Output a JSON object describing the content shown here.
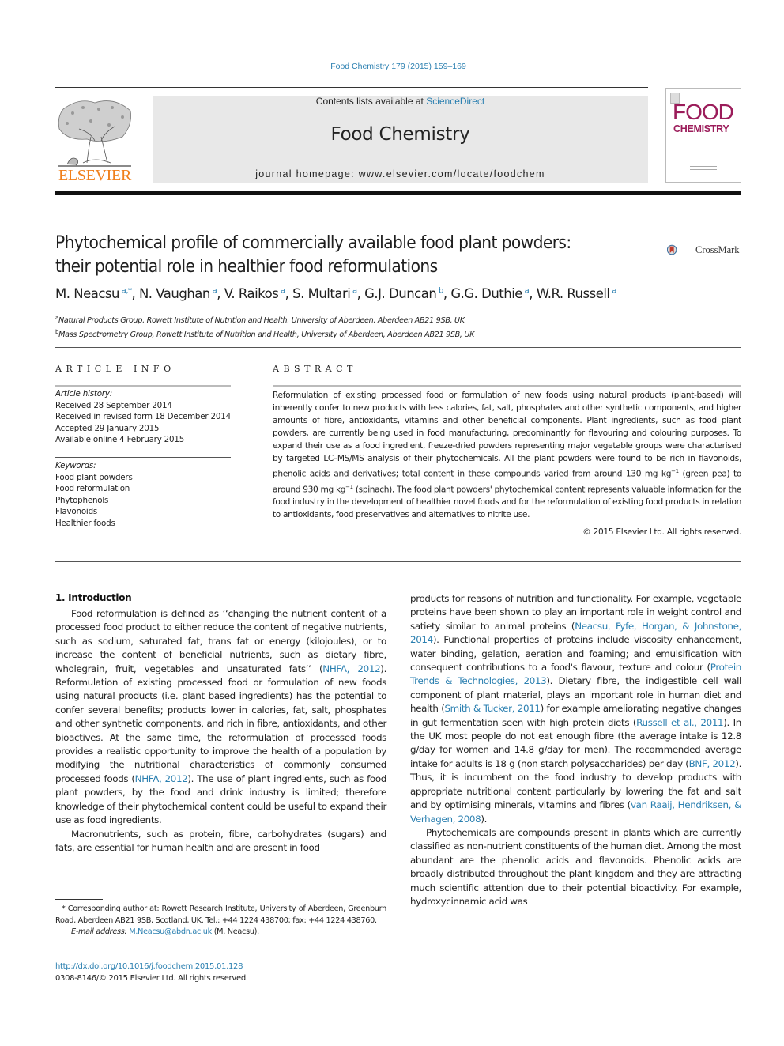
{
  "citation": "Food Chemistry 179 (2015) 159–169",
  "header": {
    "contents_prefix": "Contents lists available at ",
    "contents_link": "ScienceDirect",
    "journal_name": "Food Chemistry",
    "homepage": "journal homepage: www.elsevier.com/locate/foodchem",
    "publisher_logo": "ELSEVIER",
    "cover_line1": "FOOD",
    "cover_line2": "CHEMISTRY",
    "brand_colors": {
      "elsevier_orange": "#f07f1a",
      "cover_magenta": "#9b1c5a",
      "link_blue": "#2a7fb0"
    }
  },
  "article": {
    "title_line1": "Phytochemical profile of commercially available food plant powders:",
    "title_line2": "their potential role in healthier food reformulations",
    "crossmark_label": "CrossMark",
    "authors": [
      {
        "name": "M. Neacsu",
        "aff": "a,*"
      },
      {
        "name": "N. Vaughan",
        "aff": "a"
      },
      {
        "name": "V. Raikos",
        "aff": "a"
      },
      {
        "name": "S. Multari",
        "aff": "a"
      },
      {
        "name": "G.J. Duncan",
        "aff": "b"
      },
      {
        "name": "G.G. Duthie",
        "aff": "a"
      },
      {
        "name": "W.R. Russell",
        "aff": "a"
      }
    ],
    "affiliations": [
      {
        "key": "a",
        "text": "Natural Products Group, Rowett Institute of Nutrition and Health, University of Aberdeen, Aberdeen AB21 9SB, UK"
      },
      {
        "key": "b",
        "text": "Mass Spectrometry Group, Rowett Institute of Nutrition and Health, University of Aberdeen, Aberdeen AB21 9SB, UK"
      }
    ]
  },
  "article_info": {
    "heading": "ARTICLE INFO",
    "history_label": "Article history:",
    "history": [
      "Received 28 September 2014",
      "Received in revised form 18 December 2014",
      "Accepted 29 January 2015",
      "Available online 4 February 2015"
    ],
    "keywords_label": "Keywords:",
    "keywords": [
      "Food plant powders",
      "Food reformulation",
      "Phytophenols",
      "Flavonoids",
      "Healthier foods"
    ]
  },
  "abstract": {
    "heading": "ABSTRACT",
    "part1": "Reformulation of existing processed food or formulation of new foods using natural products (plant-based) will inherently confer to new products with less calories, fat, salt, phosphates and other synthetic components, and higher amounts of fibre, antioxidants, vitamins and other beneficial components. Plant ingredients, such as food plant powders, are currently being used in food manufacturing, predominantly for flavouring and colouring purposes. To expand their use as a food ingredient, freeze-dried powders representing major vegetable groups were characterised by targeted LC–MS/MS analysis of their phytochemicals. All the plant powders were found to be rich in flavonoids, phenolic acids and derivatives; total content in these compounds varied from around 130 mg kg",
    "sup1": "−1",
    "part2": " (green pea) to around 930 mg kg",
    "sup2": "−1",
    "part3": " (spinach). The food plant powders' phytochemical content represents valuable information for the food industry in the development of healthier novel foods and for the reformulation of existing food products in relation to antioxidants, food preservatives and alternatives to nitrite use.",
    "copyright": "© 2015 Elsevier Ltd. All rights reserved."
  },
  "body": {
    "intro_heading": "1. Introduction",
    "left_p1": [
      "Food reformulation is defined as ‘‘changing the nutrient content of a processed food product to either reduce the content of negative nutrients, such as sodium, saturated fat, trans fat or energy (kilojoules), or to increase the content of beneficial nutrients, such as dietary fibre, wholegrain, fruit, vegetables and unsaturated fats’’ (",
      "NHFA, 2012",
      "). Reformulation of existing processed food or formulation of new foods using natural products (i.e. plant based ingredients) has the potential to confer several benefits; products lower in calories, fat, salt, phosphates and other synthetic components, and rich in fibre, antioxidants, and other bioactives. At the same time, the reformulation of processed foods provides a realistic opportunity to improve the health of a population by modifying the nutritional characteristics of commonly consumed processed foods (",
      "NHFA, 2012",
      "). The use of plant ingredients, such as food plant powders, by the food and drink industry is limited; therefore knowledge of their phytochemical content could be useful to expand their use as food ingredients."
    ],
    "left_p2": "Macronutrients, such as protein, fibre, carbohydrates (sugars) and fats, are essential for human health and are present in food",
    "right_p1": [
      "products for reasons of nutrition and functionality. For example, vegetable proteins have been shown to play an important role in weight control and satiety similar to animal proteins (",
      "Neacsu, Fyfe, Horgan, & Johnstone, 2014",
      "). Functional properties of proteins include viscosity enhancement, water binding, gelation, aeration and foaming; and emulsification with consequent contributions to a food's flavour, texture and colour (",
      "Protein Trends & Technologies, 2013",
      "). Dietary fibre, the indigestible cell wall component of plant material, plays an important role in human diet and health (",
      "Smith & Tucker, 2011",
      ") for example ameliorating negative changes in gut fermentation seen with high protein diets (",
      "Russell et al., 2011",
      "). In the UK most people do not eat enough fibre (the average intake is 12.8 g/day for women and 14.8 g/day for men). The recommended average intake for adults is 18 g (non starch polysaccharides) per day (",
      "BNF, 2012",
      "). Thus, it is incumbent on the food industry to develop products with appropriate nutritional content particularly by lowering the fat and salt and by optimising minerals, vitamins and fibres (",
      "van Raaij, Hendriksen, & Verhagen, 2008",
      ")."
    ],
    "right_p2": "Phytochemicals are compounds present in plants which are currently classified as non-nutrient constituents of the human diet. Among the most abundant are the phenolic acids and flavonoids. Phenolic acids are broadly distributed throughout the plant kingdom and they are attracting much scientific attention due to their potential bioactivity. For example, hydroxycinnamic acid was"
  },
  "footnote": {
    "corresponding": "* Corresponding author at: Rowett Research Institute, University of Aberdeen, Greenburn Road, Aberdeen AB21 9SB, Scotland, UK. Tel.: +44 1224 438700; fax: +44 1224 438760.",
    "email_label": "E-mail address: ",
    "email": "M.Neacsu@abdn.ac.uk",
    "email_suffix": " (M. Neacsu).",
    "doi": "http://dx.doi.org/10.1016/j.foodchem.2015.01.128",
    "issn": "0308-8146/© 2015 Elsevier Ltd. All rights reserved."
  }
}
